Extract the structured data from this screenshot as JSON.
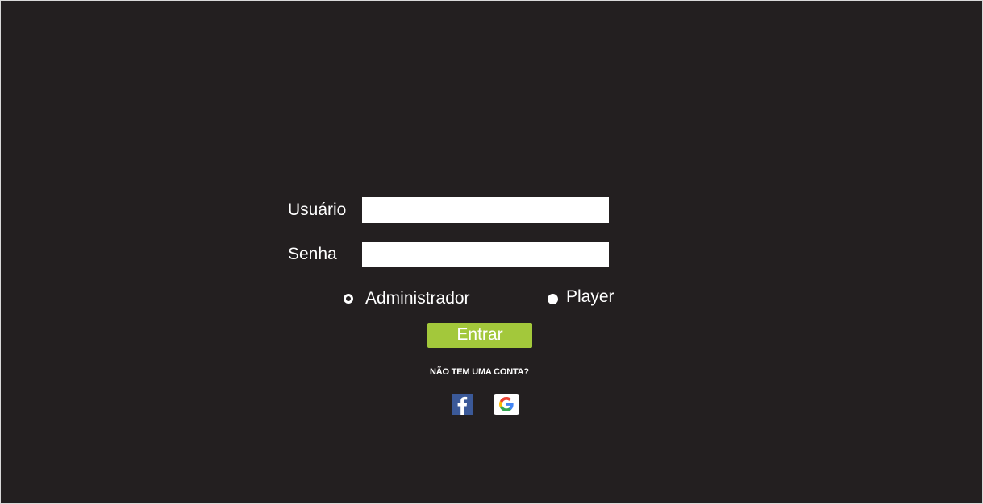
{
  "login": {
    "username_label": "Usuário",
    "username_value": "",
    "password_label": "Senha",
    "password_value": "",
    "role_options": [
      {
        "label": "Administrador",
        "selected": false
      },
      {
        "label": "Player",
        "selected": true
      }
    ],
    "submit_label": "Entrar",
    "signup_prompt": "NÃO TEM UMA CONTA?",
    "social": [
      {
        "name": "facebook",
        "icon": "facebook-icon",
        "color": "#3b5998"
      },
      {
        "name": "google",
        "icon": "google-icon",
        "color": "#ffffff"
      }
    ]
  },
  "colors": {
    "background": "#231f20",
    "accent": "#a3c83b",
    "text": "#ffffff"
  }
}
